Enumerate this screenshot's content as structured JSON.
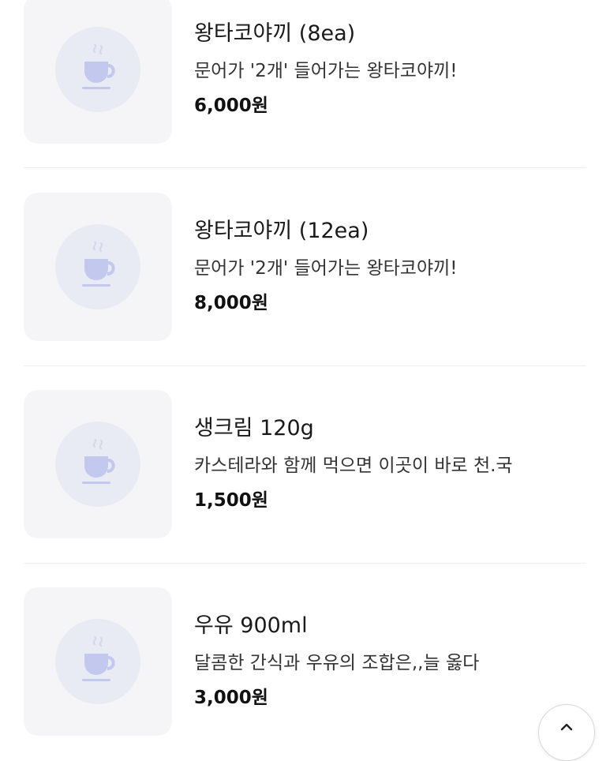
{
  "menu": {
    "items": [
      {
        "name": "왕타코야끼 (8ea)",
        "description": "문어가 '2개' 들어가는 왕타코야끼!",
        "price": "6,000원",
        "icon": "coffee-cup-icon"
      },
      {
        "name": "왕타코야끼 (12ea)",
        "description": "문어가 '2개' 들어가는 왕타코야끼!",
        "price": "8,000원",
        "icon": "coffee-cup-icon"
      },
      {
        "name": "생크림 120g",
        "description": "카스테라와 함께 먹으면 이곳이 바로 천.국",
        "price": "1,500원",
        "icon": "coffee-cup-icon"
      },
      {
        "name": "우유 900ml",
        "description": "달콤한 간식과 우유의 조합은,,늘 옳다",
        "price": "3,000원",
        "icon": "coffee-cup-icon"
      }
    ]
  },
  "scroll_top": {
    "icon": "chevron-up-icon"
  },
  "colors": {
    "thumb_background": "#f5f5f7",
    "icon_circle": "#e9ebf4",
    "icon_tint": "#c3c8ee",
    "divider": "#eeeeee"
  }
}
